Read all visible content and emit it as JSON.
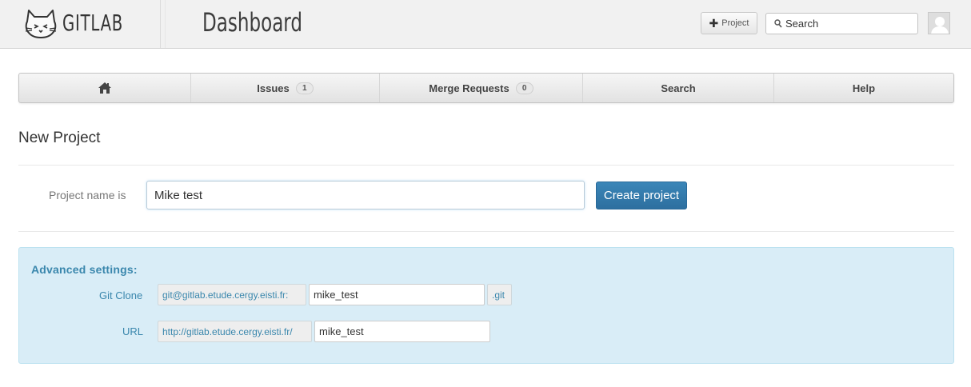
{
  "header": {
    "logo_text": "GITLAB",
    "title": "Dashboard",
    "project_button_label": "Project",
    "search_placeholder": "Search"
  },
  "nav": {
    "items": [
      {
        "label": "",
        "icon": "home-icon"
      },
      {
        "label": "Issues",
        "badge": "1"
      },
      {
        "label": "Merge Requests",
        "badge": "0"
      },
      {
        "label": "Search"
      },
      {
        "label": "Help"
      }
    ]
  },
  "main": {
    "heading": "New Project",
    "name_label": "Project name is",
    "name_value": "Mike test",
    "create_button": "Create project"
  },
  "advanced": {
    "title": "Advanced settings:",
    "git_clone_label": "Git Clone",
    "git_clone_prefix": "git@gitlab.etude.cergy.eisti.fr:",
    "git_clone_value": "mike_test",
    "git_clone_suffix": ".git",
    "url_label": "URL",
    "url_prefix": "http://gitlab.etude.cergy.eisti.fr/",
    "url_value": "mike_test"
  },
  "colors": {
    "header_bg": "#f1f1f1",
    "primary_button": "#3076a8",
    "info_bg": "#d9edf7",
    "info_text": "#3a87ad"
  }
}
